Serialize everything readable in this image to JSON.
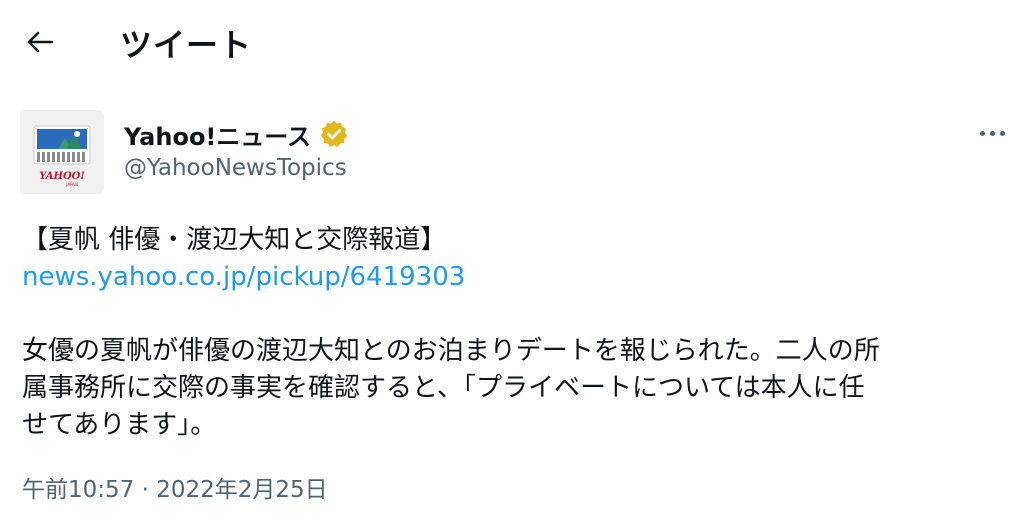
{
  "header": {
    "back_icon": "arrow-left-icon",
    "title": "ツイート"
  },
  "author": {
    "display_name": "Yahoo!ニュース",
    "handle": "@YahooNewsTopics",
    "verified_icon": "verified-badge-icon",
    "verified_color": "#e2b719",
    "avatar_logo_text": "YAHOO!",
    "avatar_logo_subtext": "JAPAN"
  },
  "more_icon": "more-horizontal-icon",
  "tweet": {
    "headline": "【夏帆 俳優・渡辺大知と交際報道】",
    "link": "news.yahoo.co.jp/pickup/6419303",
    "body_line1": "女優の夏帆が俳優の渡辺大知とのお泊まりデートを報じられた。二人の所",
    "body_line2": "属事務所に交際の事実を確認すると、「プライベートについては本人に任",
    "body_line3": "せてあります」。"
  },
  "timestamp": "午前10:57 · 2022年2月25日",
  "colors": {
    "link": "#1d9bf0",
    "secondary_text": "#536471",
    "primary_text": "#0f1419"
  }
}
